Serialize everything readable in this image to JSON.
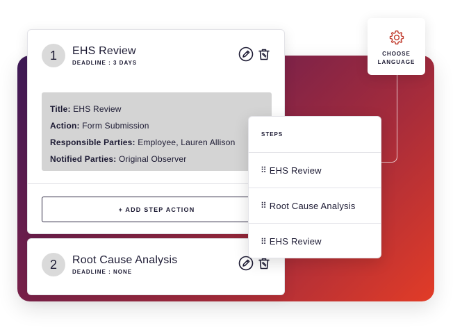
{
  "steps": [
    {
      "number": "1",
      "title": "EHS Review",
      "deadline": "DEADLINE : 3 DAYS",
      "details": {
        "title_label": "Title:",
        "title_value": "EHS Review",
        "action_label": "Action:",
        "action_value": "Form Submission",
        "responsible_label": "Responsible Parties:",
        "responsible_value": "Employee, Lauren Allison",
        "notified_label": "Notified Parties:",
        "notified_value": "Original Observer"
      },
      "add_action_label": "+ ADD STEP ACTION"
    },
    {
      "number": "2",
      "title": "Root Cause Analysis",
      "deadline": "DEADLINE : NONE"
    }
  ],
  "language": {
    "label_line1": "CHOOSE",
    "label_line2": "LANGUAGE",
    "icon": "gear-icon"
  },
  "steps_panel": {
    "header": "STEPS",
    "grip": "⠿",
    "items": [
      "EHS Review",
      "Root Cause Analysis",
      "EHS Review"
    ]
  },
  "colors": {
    "gradient_start": "#3d1a57",
    "gradient_end": "#e23c27",
    "accent_red": "#c0392b",
    "text": "#1c1a33"
  }
}
